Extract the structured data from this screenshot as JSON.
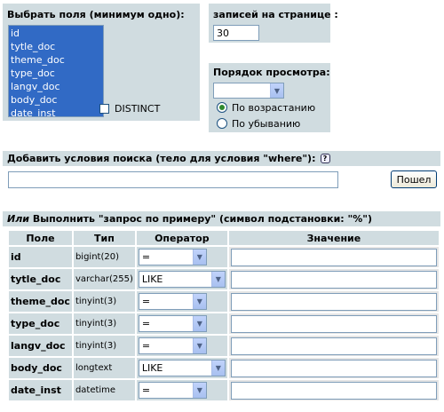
{
  "fields_panel": {
    "title": "Выбрать поля (минимум одно):",
    "options": [
      "id",
      "tytle_doc",
      "theme_doc",
      "type_doc",
      "langv_doc",
      "body_doc",
      "date_inst"
    ],
    "distinct_label": "DISTINCT"
  },
  "per_page": {
    "label": "записей на странице :",
    "value": "30"
  },
  "order": {
    "label": "Порядок просмотра:",
    "select_value": "",
    "asc_label": "По возрастанию",
    "desc_label": "По убыванию",
    "selected": "asc"
  },
  "where": {
    "label": "Добавить условия поиска (тело для условия \"where\"):",
    "help_icon": "?",
    "value": "",
    "go_button": "Пошел"
  },
  "qbe": {
    "title_em": "Или",
    "title_rest": " Выполнить \"запрос по примеру\" (символ подстановки: \"%\")",
    "headers": [
      "Поле",
      "Тип",
      "Оператор",
      "Значение"
    ],
    "rows": [
      {
        "field": "id",
        "type": "bigint(20)",
        "operator": "="
      },
      {
        "field": "tytle_doc",
        "type": "varchar(255)",
        "operator": "LIKE"
      },
      {
        "field": "theme_doc",
        "type": "tinyint(3)",
        "operator": "="
      },
      {
        "field": "type_doc",
        "type": "tinyint(3)",
        "operator": "="
      },
      {
        "field": "langv_doc",
        "type": "tinyint(3)",
        "operator": "="
      },
      {
        "field": "body_doc",
        "type": "longtext",
        "operator": "LIKE"
      },
      {
        "field": "date_inst",
        "type": "datetime",
        "operator": "="
      }
    ]
  }
}
